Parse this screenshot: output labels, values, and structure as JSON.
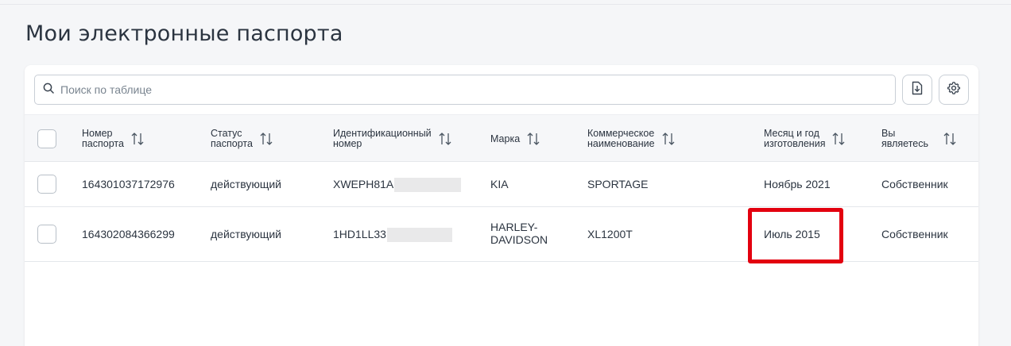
{
  "page": {
    "title": "Мои электронные паспорта"
  },
  "search": {
    "placeholder": "Поиск по таблице"
  },
  "toolbar": {
    "download_icon": "download-file-icon",
    "settings_icon": "gear-icon"
  },
  "columns": [
    "Номер\nпаспорта",
    "Статус\nпаспорта",
    "Идентификационный\nномер",
    "Марка",
    "Коммерческое\nнаименование",
    "Месяц и год\nизготовления",
    "Вы\nявляетесь"
  ],
  "rows": [
    {
      "passport_number": "164301037172976",
      "status": "действующий",
      "vin_visible": "XWEPH81A",
      "brand": "KIA",
      "model": "SPORTAGE",
      "manufactured": "Ноябрь 2021",
      "role": "Собственник"
    },
    {
      "passport_number": "164302084366299",
      "status": "действующий",
      "vin_visible": "1HD1LL33",
      "brand": "HARLEY-\nDAVIDSON",
      "model": "XL1200T",
      "manufactured": "Июль 2015",
      "role": "Собственник"
    }
  ],
  "colors": {
    "highlight": "#e3000f",
    "header_bg": "#f6f7f9",
    "border": "#e4e7eb"
  }
}
